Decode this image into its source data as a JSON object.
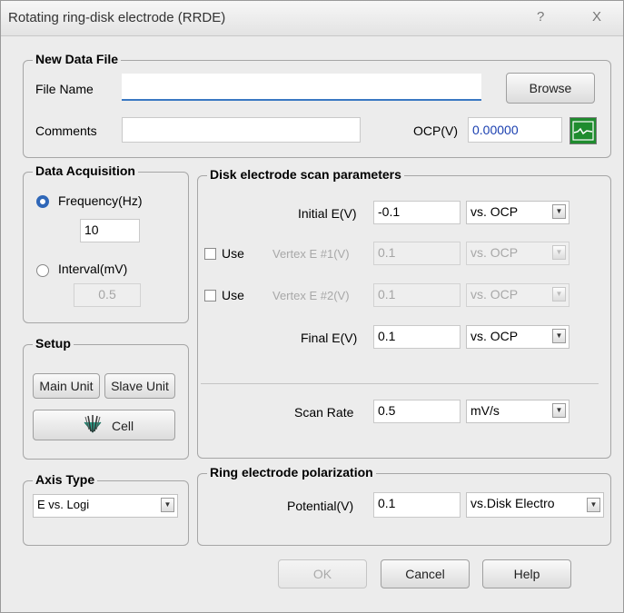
{
  "window": {
    "title": "Rotating ring-disk electrode (RRDE)",
    "help_glyph": "?",
    "close_glyph": "X"
  },
  "new_data_file": {
    "legend": "New Data File",
    "file_name_label": "File Name",
    "file_name_value": "",
    "browse_label": "Browse",
    "comments_label": "Comments",
    "comments_value": "",
    "ocp_label": "OCP(V)",
    "ocp_value": "0.00000",
    "graph_icon": "chart-icon"
  },
  "data_acquisition": {
    "legend": "Data Acquisition",
    "frequency_label": "Frequency(Hz)",
    "frequency_value": "10",
    "frequency_selected": true,
    "interval_label": "Interval(mV)",
    "interval_value": "0.5",
    "interval_selected": false
  },
  "setup": {
    "legend": "Setup",
    "main_unit_label": "Main Unit",
    "slave_unit_label": "Slave Unit",
    "cell_label": "Cell",
    "cell_icon": "electrode-cell-icon"
  },
  "axis_type": {
    "legend": "Axis Type",
    "value": "E vs. Logi"
  },
  "disk_scan": {
    "legend": "Disk electrode scan parameters",
    "use_label": "Use",
    "initial_label": "Initial E(V)",
    "initial_value": "-0.1",
    "initial_ref": "vs. OCP",
    "vertex1_label": "Vertex E #1(V)",
    "vertex1_value": "0.1",
    "vertex1_ref": "vs. OCP",
    "vertex1_enabled": false,
    "vertex2_label": "Vertex E #2(V)",
    "vertex2_value": "0.1",
    "vertex2_ref": "vs. OCP",
    "vertex2_enabled": false,
    "final_label": "Final E(V)",
    "final_value": "0.1",
    "final_ref": "vs. OCP",
    "scan_rate_label": "Scan Rate",
    "scan_rate_value": "0.5",
    "scan_rate_unit": "mV/s"
  },
  "ring": {
    "legend": "Ring electrode polarization",
    "potential_label": "Potential(V)",
    "potential_value": "0.1",
    "potential_ref": "vs.Disk Electro"
  },
  "footer": {
    "ok_label": "OK",
    "cancel_label": "Cancel",
    "help_label": "Help"
  },
  "colors": {
    "accent": "#2f67b8",
    "ocp_value": "#1a3fb0",
    "graph_bg": "#1f8c2e"
  }
}
